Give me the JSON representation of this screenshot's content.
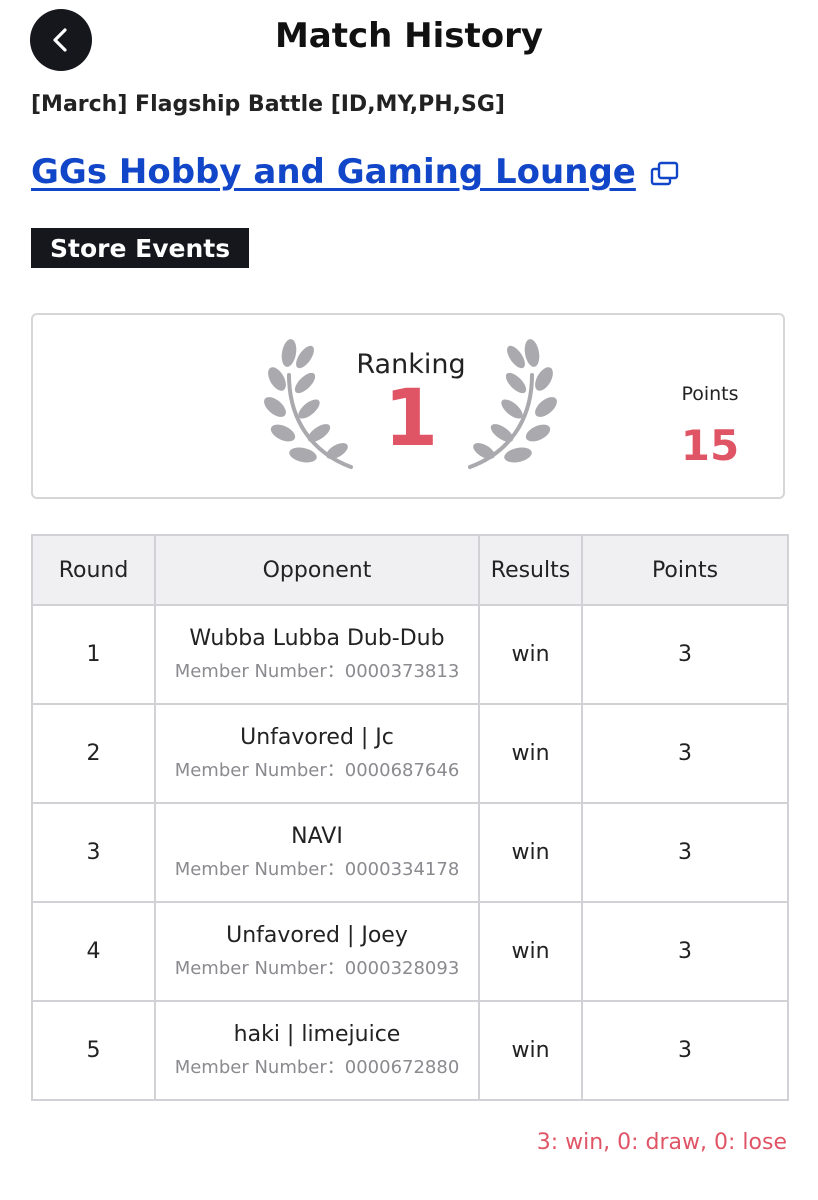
{
  "header": {
    "title": "Match History"
  },
  "event": {
    "name": "[March] Flagship Battle [ID,MY,PH,SG]",
    "store_name": "GGs Hobby and Gaming Lounge",
    "badge": "Store Events"
  },
  "summary": {
    "ranking_label": "Ranking",
    "ranking_value": "1",
    "points_label": "Points",
    "points_value": "15",
    "accent_color": "#e05566"
  },
  "table": {
    "columns": [
      "Round",
      "Opponent",
      "Results",
      "Points"
    ],
    "rows": [
      {
        "round": "1",
        "opponent": "Wubba Lubba Dub-Dub",
        "member": "Member Number：0000373813",
        "result": "win",
        "points": "3"
      },
      {
        "round": "2",
        "opponent": "Unfavored | Jc",
        "member": "Member Number：0000687646",
        "result": "win",
        "points": "3"
      },
      {
        "round": "3",
        "opponent": "NAVI",
        "member": "Member Number：0000334178",
        "result": "win",
        "points": "3"
      },
      {
        "round": "4",
        "opponent": "Unfavored | Joey",
        "member": "Member Number：0000328093",
        "result": "win",
        "points": "3"
      },
      {
        "round": "5",
        "opponent": "haki | limejuice",
        "member": "Member Number：0000672880",
        "result": "win",
        "points": "3"
      }
    ]
  },
  "legend": "3: win, 0: draw, 0: lose",
  "icons": {
    "back": "chevron-left-icon",
    "external": "external-window-icon",
    "laurel": "laurel-wreath-icon"
  }
}
